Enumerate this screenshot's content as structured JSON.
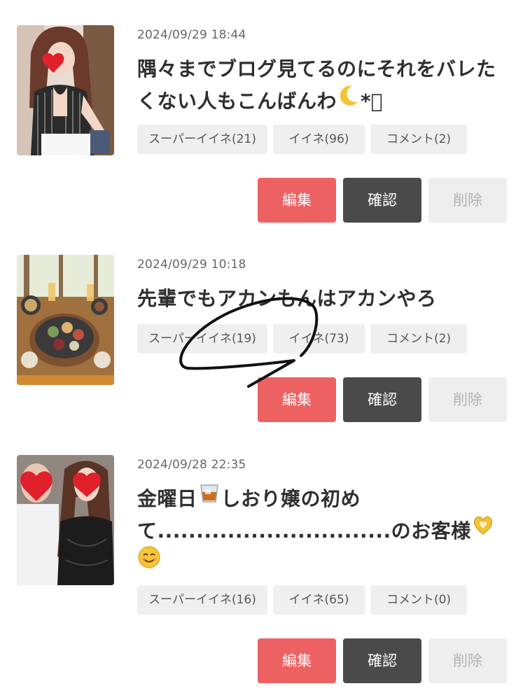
{
  "posts": [
    {
      "date": "2024/09/29 18:44",
      "title": "隅々までブログ見てるのにそれをバレたくない人もこんばんわ",
      "title_tail": "*ﾟ",
      "super_like": "スーパーイイネ(21)",
      "like": "イイネ(96)",
      "comment": "コメント(2)",
      "thumb_icon": "heart-sticker-icon"
    },
    {
      "date": "2024/09/29 10:18",
      "title": "先輩でもアカンもんはアカンやろ",
      "super_like": "スーパーイイネ(19)",
      "like": "イイネ(73)",
      "comment": "コメント(2)"
    },
    {
      "date": "2024/09/28 22:35",
      "title_line1_pre": "金曜日",
      "title_line1_post": "しおり嬢の初め",
      "title_line2": "て..............................のお客様",
      "super_like": "スーパーイイネ(16)",
      "like": "イイネ(65)",
      "comment": "コメント(0)"
    }
  ],
  "actions": {
    "edit": "編集",
    "confirm": "確認",
    "delete": "削除"
  },
  "colors": {
    "edit": "#ee6163",
    "confirm": "#4a4a4a",
    "delete_bg": "#eeeeee",
    "chip_bg": "#efefef"
  }
}
